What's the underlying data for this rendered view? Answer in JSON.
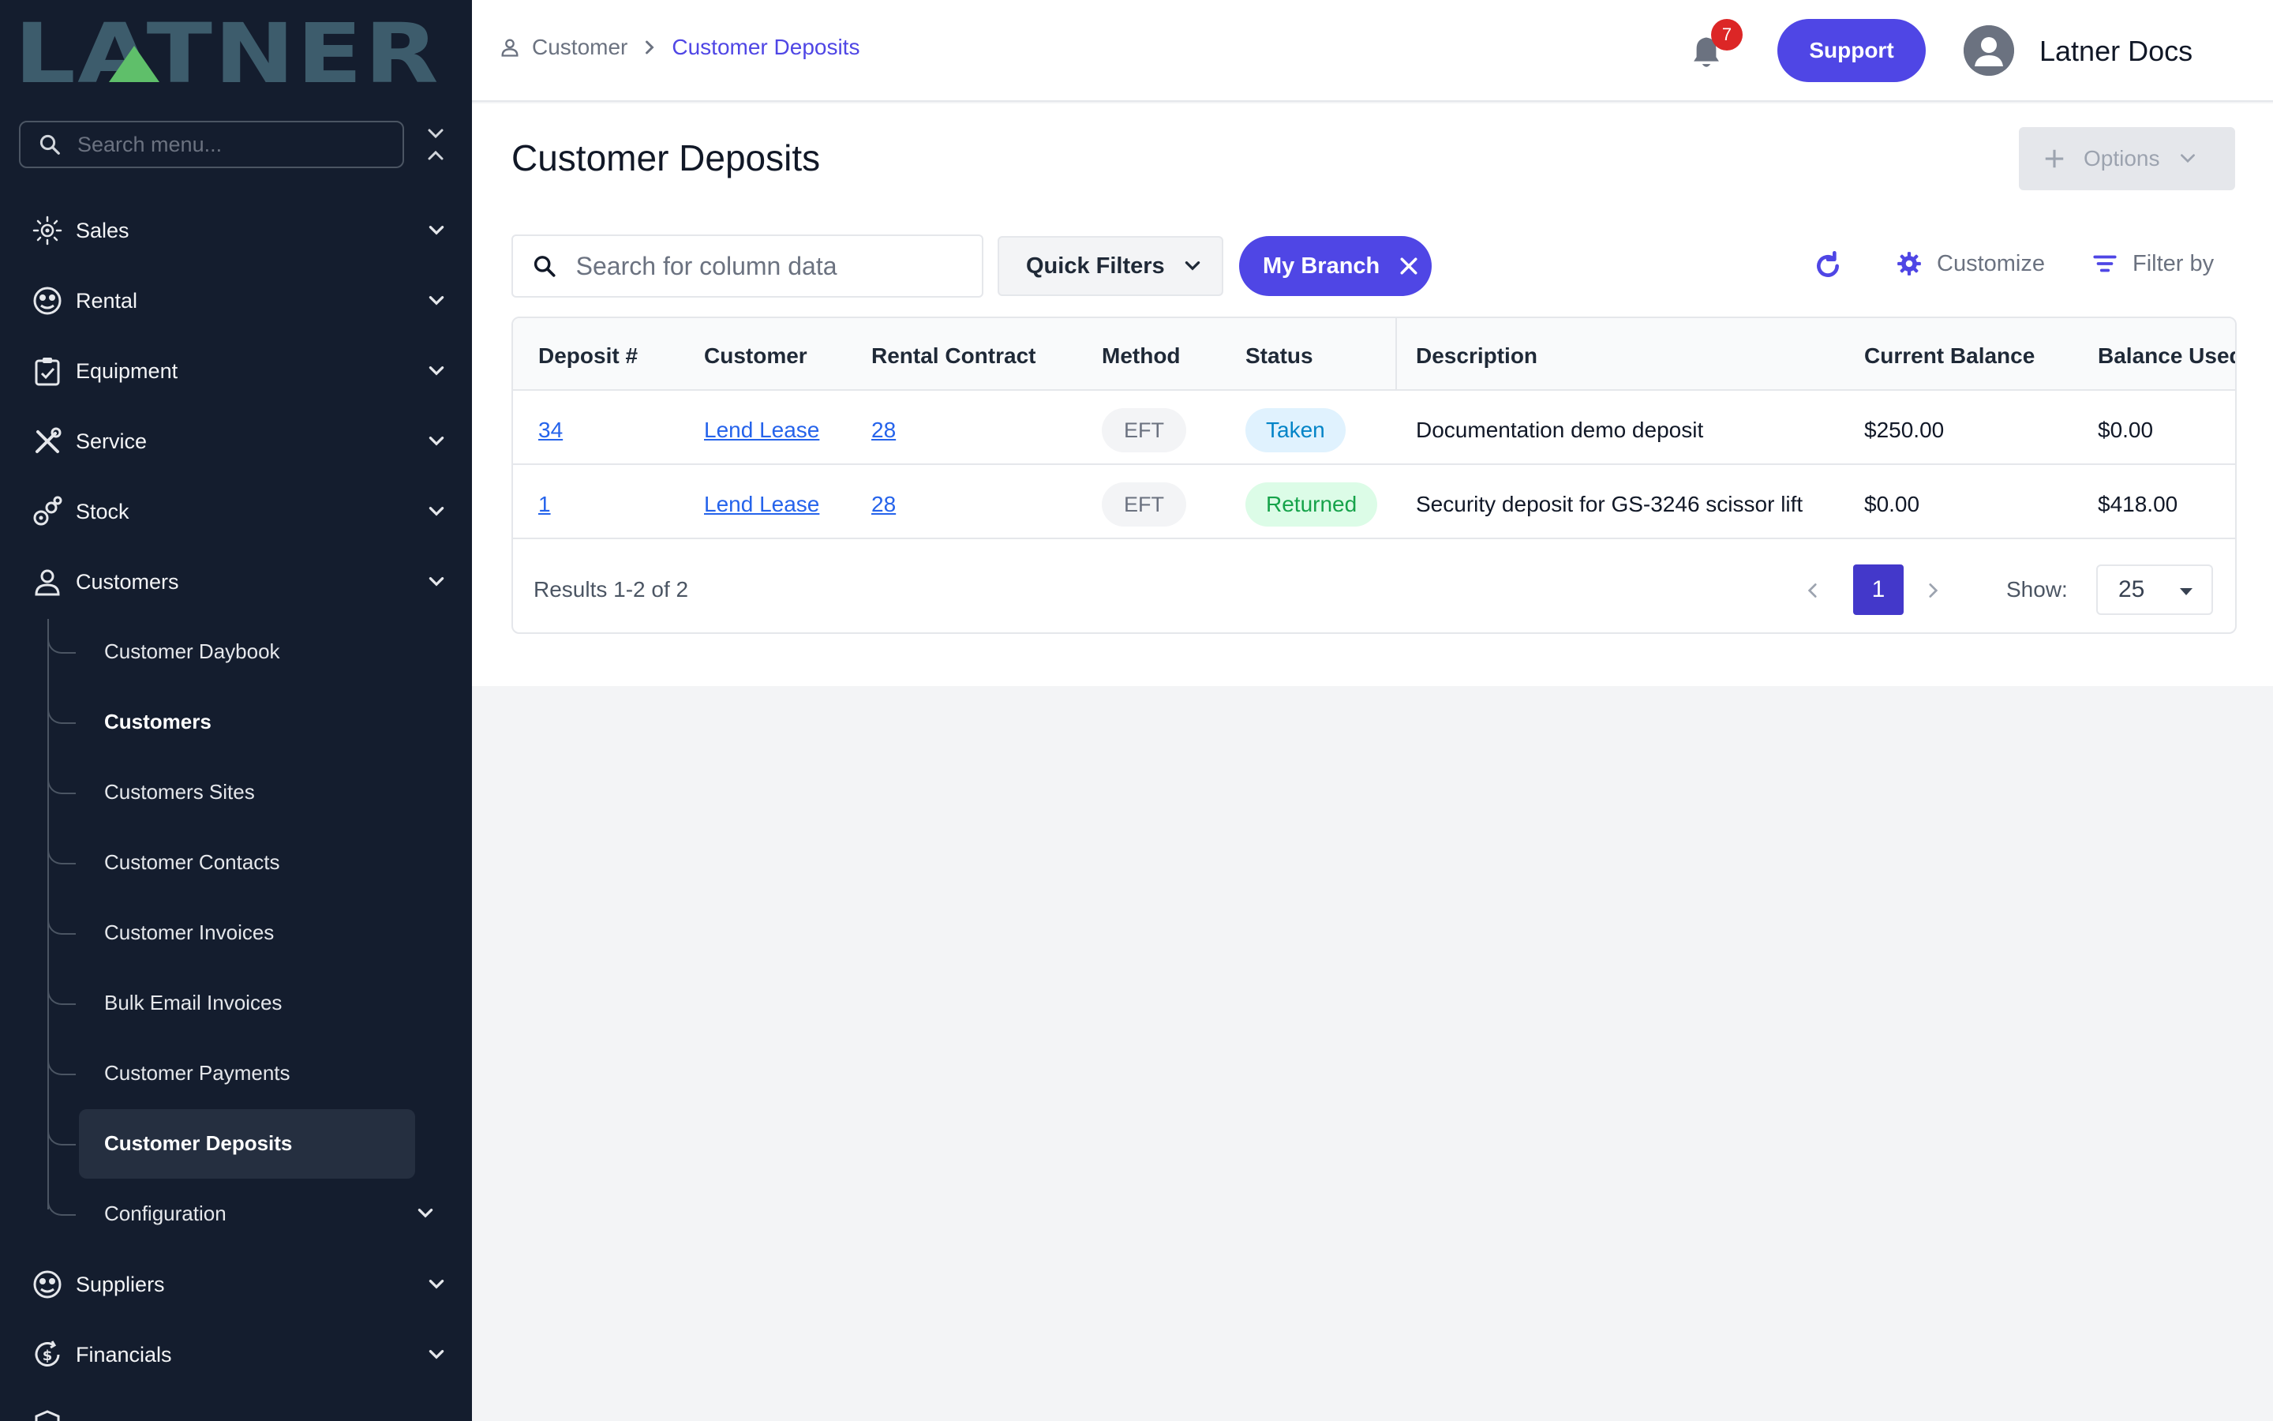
{
  "sidebar": {
    "logo_text": "LATNER",
    "search_placeholder": "Search menu...",
    "items": [
      {
        "label": "Sales",
        "icon": "sales-icon"
      },
      {
        "label": "Rental",
        "icon": "rental-icon"
      },
      {
        "label": "Equipment",
        "icon": "equipment-icon"
      },
      {
        "label": "Service",
        "icon": "service-icon"
      },
      {
        "label": "Stock",
        "icon": "stock-icon"
      },
      {
        "label": "Customers",
        "icon": "customers-icon"
      }
    ],
    "customer_sub_items": [
      {
        "label": "Customer Daybook"
      },
      {
        "label": "Customers"
      },
      {
        "label": "Customers Sites"
      },
      {
        "label": "Customer Contacts"
      },
      {
        "label": "Customer Invoices"
      },
      {
        "label": "Bulk Email Invoices"
      },
      {
        "label": "Customer Payments"
      },
      {
        "label": "Customer Deposits"
      },
      {
        "label": "Configuration"
      }
    ],
    "bottom_items": [
      {
        "label": "Suppliers",
        "icon": "suppliers-icon"
      },
      {
        "label": "Financials",
        "icon": "financials-icon"
      }
    ]
  },
  "header": {
    "breadcrumb_root": "Customer",
    "breadcrumb_current": "Customer Deposits",
    "notification_count": "7",
    "support_label": "Support",
    "user_name": "Latner Docs"
  },
  "main": {
    "title": "Customer Deposits",
    "options_label": "Options",
    "search_placeholder": "Search for column data",
    "quick_filters_label": "Quick Filters",
    "active_filter_chip": "My Branch",
    "customize_label": "Customize",
    "filter_by_label": "Filter by"
  },
  "table": {
    "columns": [
      "Deposit #",
      "Customer",
      "Rental Contract",
      "Method",
      "Status",
      "Description",
      "Current Balance",
      "Balance Used"
    ],
    "rows": [
      {
        "deposit": "34",
        "customer": "Lend Lease",
        "contract": "28",
        "method": "EFT",
        "status": "Taken",
        "description": "Documentation demo deposit",
        "current_balance": "$250.00",
        "balance_used": "$0.00"
      },
      {
        "deposit": "1",
        "customer": "Lend Lease",
        "contract": "28",
        "method": "EFT",
        "status": "Returned",
        "description": "Security deposit for GS-3246 scissor lift",
        "current_balance": "$0.00",
        "balance_used": "$418.00"
      }
    ],
    "results_text": "Results 1-2 of 2",
    "current_page": "1",
    "show_label": "Show:",
    "page_size": "25"
  },
  "colors": {
    "sidebar_bg": "#141d2e",
    "accent": "#4f46e5",
    "link": "#2563eb",
    "status_taken": "#0284c7",
    "status_returned": "#16a34a",
    "badge_red": "#dc2626"
  }
}
